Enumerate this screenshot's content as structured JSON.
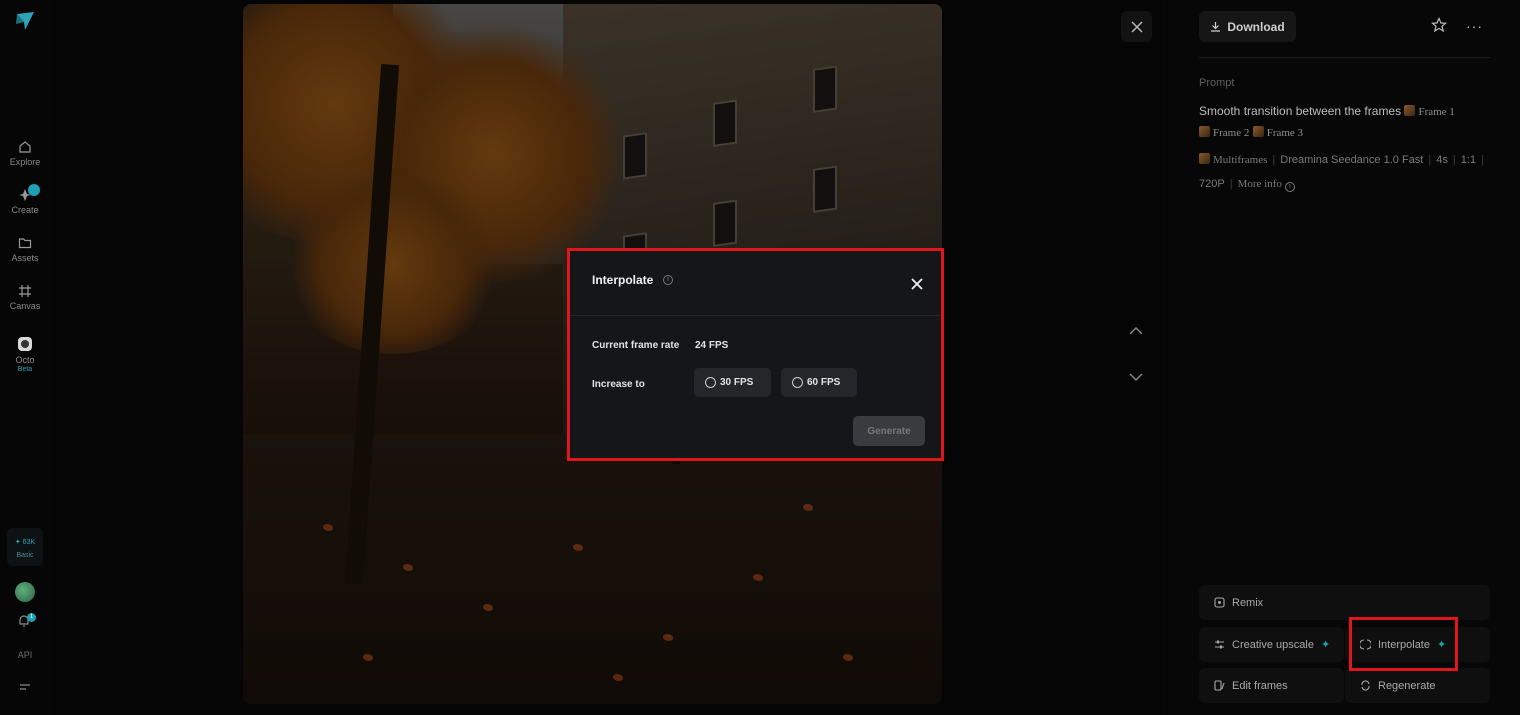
{
  "sidebar": {
    "items": [
      {
        "label": "Explore",
        "icon": "home-icon"
      },
      {
        "label": "Create",
        "icon": "create-icon"
      },
      {
        "label": "Assets",
        "icon": "folder-icon"
      },
      {
        "label": "Canvas",
        "icon": "canvas-icon"
      },
      {
        "label": "Octo",
        "icon": "octo-icon",
        "badge": "Beta"
      }
    ],
    "credits": {
      "amount": "✦ 63K",
      "plan": "Basic"
    },
    "notification_count": "1",
    "api_label": "API"
  },
  "header": {
    "download_label": "Download"
  },
  "details": {
    "prompt_label": "Prompt",
    "prompt_text": "Smooth transition between the frames",
    "frames": [
      "Frame 1",
      "Frame 2",
      "Frame 3"
    ],
    "meta": {
      "mode": "Multiframes",
      "model": "Dreamina Seedance 1.0 Fast",
      "duration": "4s",
      "ratio": "1:1",
      "resolution": "720P",
      "more_info": "More info"
    }
  },
  "actions": {
    "remix": "Remix",
    "creative_upscale": "Creative upscale",
    "interpolate": "Interpolate",
    "edit_frames": "Edit frames",
    "regenerate": "Regenerate"
  },
  "modal": {
    "title": "Interpolate",
    "current_frame_rate_label": "Current frame rate",
    "current_frame_rate_value": "24 FPS",
    "increase_to_label": "Increase to",
    "options": [
      "30 FPS",
      "60 FPS"
    ],
    "generate_label": "Generate"
  },
  "colors": {
    "accent": "#1e9fb3",
    "highlight": "#e0161d",
    "background": "#050505"
  }
}
